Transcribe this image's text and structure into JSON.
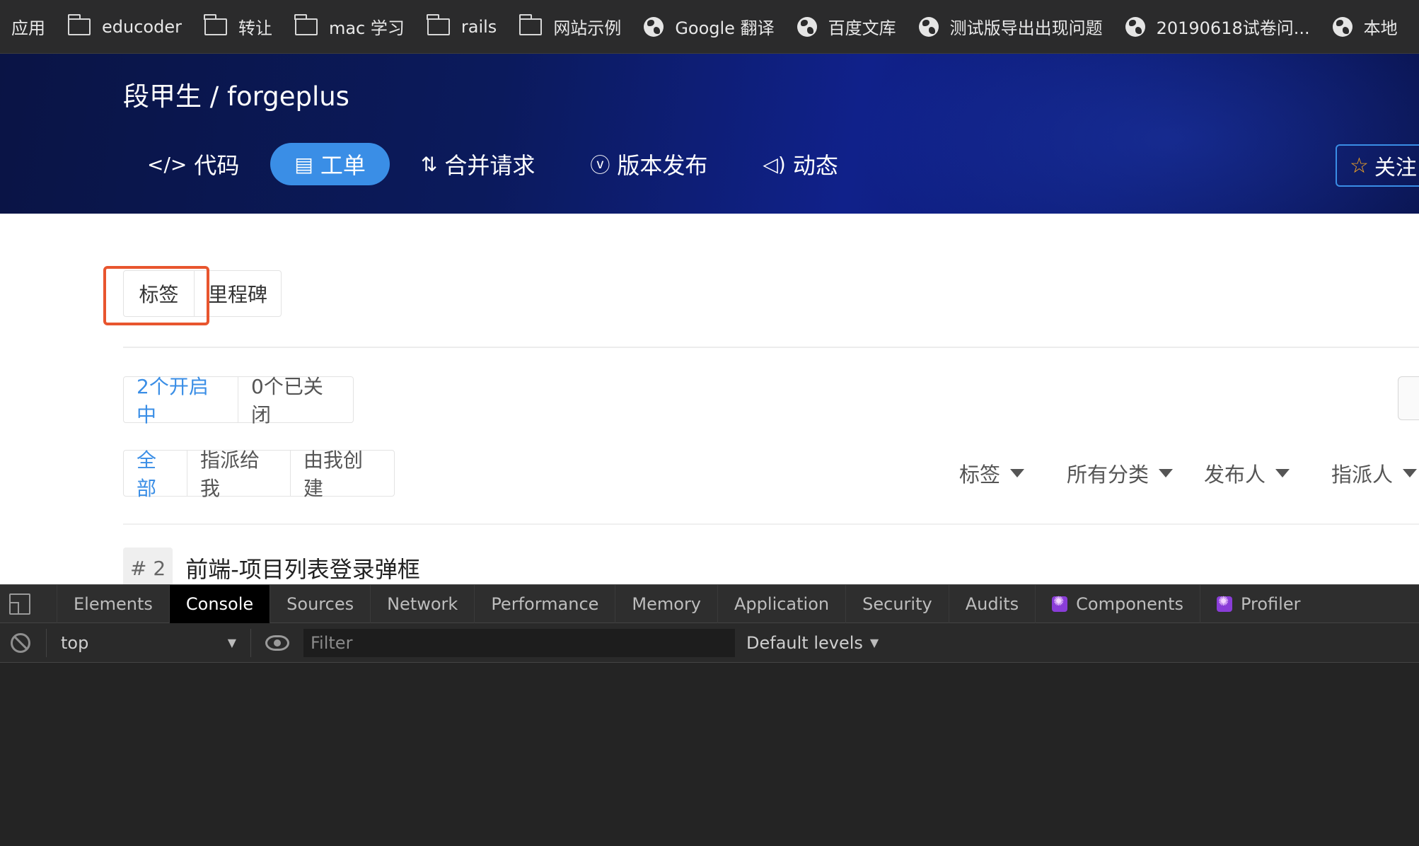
{
  "bookmarks": [
    {
      "label": "应用",
      "icon": "none"
    },
    {
      "label": "educoder",
      "icon": "folder-icon"
    },
    {
      "label": "转让",
      "icon": "folder-icon"
    },
    {
      "label": "mac 学习",
      "icon": "folder-icon"
    },
    {
      "label": "rails",
      "icon": "folder-icon"
    },
    {
      "label": "网站示例",
      "icon": "folder-icon"
    },
    {
      "label": "Google 翻译",
      "icon": "globe-icon"
    },
    {
      "label": "百度文库",
      "icon": "globe-icon"
    },
    {
      "label": "测试版导出出现问题",
      "icon": "globe-icon"
    },
    {
      "label": "20190618试卷问...",
      "icon": "globe-icon"
    },
    {
      "label": "本地",
      "icon": "globe-icon"
    }
  ],
  "repo": {
    "title": "段甲生 / forgeplus",
    "follow_label": "关注"
  },
  "nav": {
    "code": "代码",
    "issues": "工单",
    "pulls": "合并请求",
    "releases": "版本发布",
    "activity": "动态"
  },
  "sub_tabs": {
    "labels": "标签",
    "milestones": "里程碑"
  },
  "status_tabs": {
    "open": "2个开启中",
    "closed": "0个已关闭"
  },
  "scope_tabs": {
    "all": "全部",
    "assigned": "指派给我",
    "created": "由我创建"
  },
  "filters": {
    "label": "标签",
    "category": "所有分类",
    "author": "发布人",
    "assignee": "指派人"
  },
  "issue": {
    "number": "# 2",
    "title": "前端-项目列表登录弹框"
  },
  "devtools": {
    "tabs": [
      "Elements",
      "Console",
      "Sources",
      "Network",
      "Performance",
      "Memory",
      "Application",
      "Security",
      "Audits",
      "Components",
      "Profiler"
    ],
    "active_tab": "Console",
    "context": "top",
    "filter_placeholder": "Filter",
    "levels": "Default levels"
  },
  "colors": {
    "accent": "#3a8ee6",
    "highlight": "#e8552e",
    "banner_dark": "#0a1445"
  }
}
